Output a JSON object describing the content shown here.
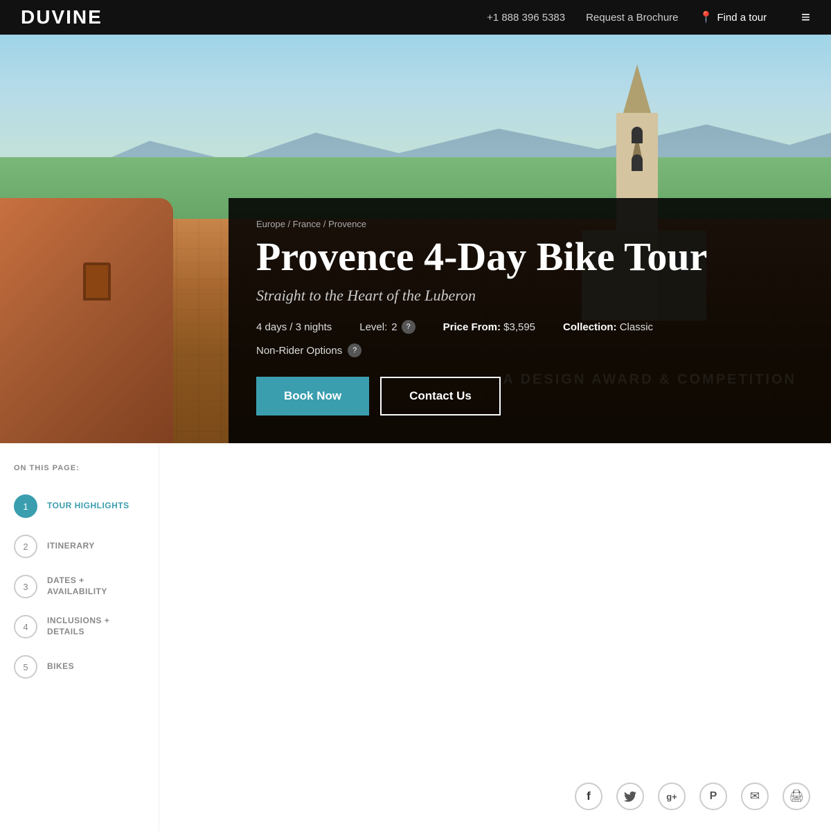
{
  "header": {
    "logo": "DUVINE",
    "phone": "+1 888 396 5383",
    "brochure_label": "Request a Brochure",
    "find_tour_label": "Find a tour",
    "menu_icon": "≡"
  },
  "hero": {
    "breadcrumb": {
      "items": [
        "Europe",
        "France",
        "Provence"
      ],
      "separator": " / "
    },
    "title": "Provence 4-Day Bike Tour",
    "subtitle": "Straight to the Heart of the Luberon",
    "meta": {
      "duration": "4 days / 3 nights",
      "level_label": "Level:",
      "level_value": "2",
      "price_label": "Price From:",
      "price_value": "$3,595",
      "collection_label": "Collection:",
      "collection_value": "Classic"
    },
    "non_rider_label": "Non-Rider Options",
    "book_button": "Book Now",
    "contact_button": "Contact Us"
  },
  "sidebar": {
    "section_label": "ON THIS PAGE:",
    "items": [
      {
        "num": "1",
        "label": "TOUR HIGHLIGHTS",
        "active": true
      },
      {
        "num": "2",
        "label": "ITINERARY",
        "active": false
      },
      {
        "num": "3",
        "label": "DATES + AVAILABILITY",
        "active": false
      },
      {
        "num": "4",
        "label": "INCLUSIONS + DETAILS",
        "active": false
      },
      {
        "num": "5",
        "label": "BIKES",
        "active": false
      }
    ]
  },
  "social": {
    "icons": [
      {
        "name": "facebook",
        "symbol": "f"
      },
      {
        "name": "twitter",
        "symbol": "🐦"
      },
      {
        "name": "google-plus",
        "symbol": "g+"
      },
      {
        "name": "pinterest",
        "symbol": "P"
      },
      {
        "name": "email",
        "symbol": "✉"
      },
      {
        "name": "print",
        "symbol": "🖨"
      }
    ]
  },
  "award_watermark": "A DESIGN AWARD & COMPETITION"
}
